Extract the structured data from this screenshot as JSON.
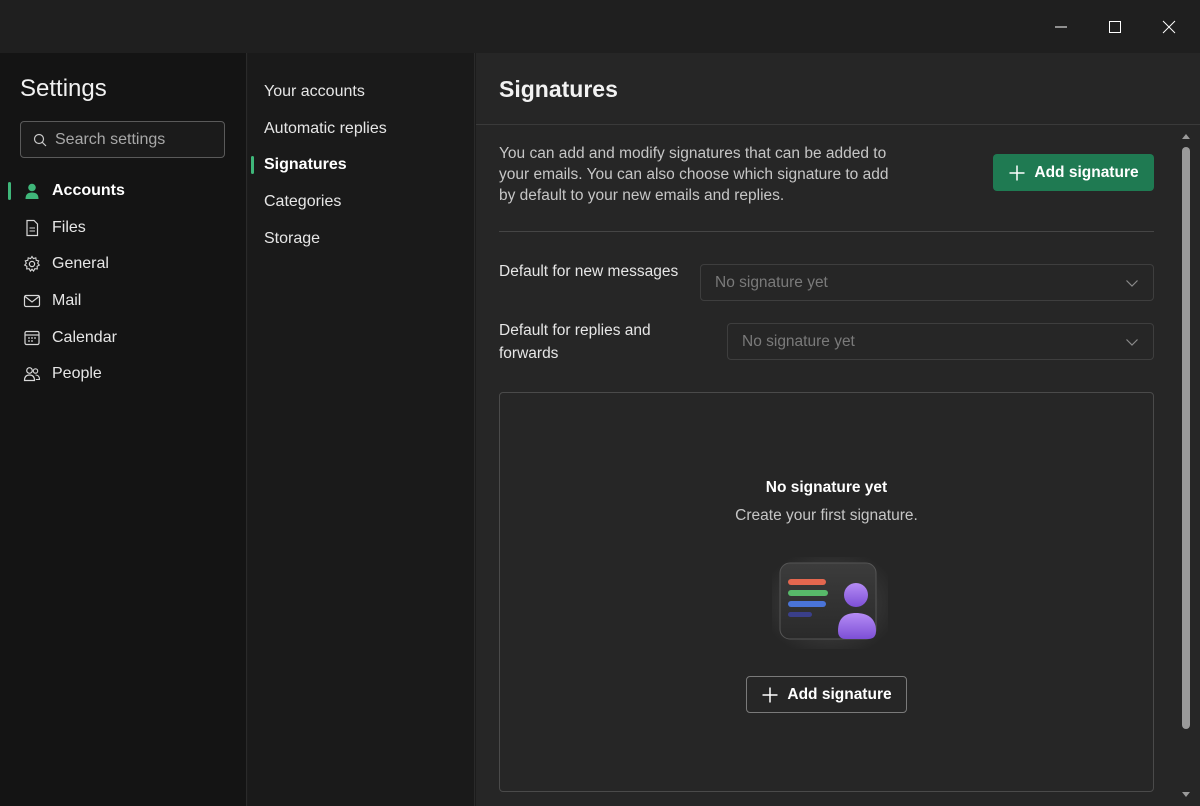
{
  "window": {
    "minimize_icon": "minimize-icon",
    "maximize_icon": "maximize-icon",
    "close_icon": "close-icon"
  },
  "sidebar": {
    "title": "Settings",
    "search": {
      "placeholder": "Search settings",
      "value": ""
    },
    "accent_color": "#3fb77a",
    "items": [
      {
        "label": "Accounts",
        "icon": "person-icon",
        "active": true
      },
      {
        "label": "Files",
        "icon": "file-icon",
        "active": false
      },
      {
        "label": "General",
        "icon": "gear-icon",
        "active": false
      },
      {
        "label": "Mail",
        "icon": "mail-icon",
        "active": false
      },
      {
        "label": "Calendar",
        "icon": "calendar-icon",
        "active": false
      },
      {
        "label": "People",
        "icon": "people-icon",
        "active": false
      }
    ]
  },
  "subnav": {
    "items": [
      {
        "label": "Your accounts",
        "active": false
      },
      {
        "label": "Automatic replies",
        "active": false
      },
      {
        "label": "Signatures",
        "active": true
      },
      {
        "label": "Categories",
        "active": false
      },
      {
        "label": "Storage",
        "active": false
      }
    ]
  },
  "main": {
    "title": "Signatures",
    "intro": "You can add and modify signatures that can be added to your emails. You can also choose which signature to add by default to your new emails and replies.",
    "add_signature_label": "Add signature",
    "primary_color": "#1f7a52",
    "default_new": {
      "label": "Default for new messages",
      "value": "No signature yet"
    },
    "default_replies": {
      "label": "Default for replies and forwards",
      "value": "No signature yet"
    },
    "empty_state": {
      "title": "No signature yet",
      "subtitle": "Create your first signature.",
      "illustration": "signature-card-illustration",
      "button_label": "Add signature"
    }
  }
}
